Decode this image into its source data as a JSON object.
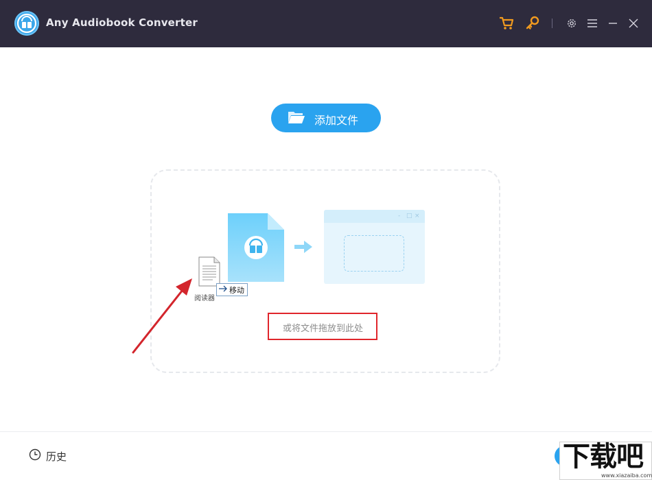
{
  "window": {
    "title": "Any Audiobook Converter",
    "controls": [
      "cart-icon",
      "key-icon",
      "gear-icon",
      "menu-icon",
      "minimize-icon",
      "close-icon"
    ]
  },
  "main": {
    "add_button_label": "添加文件",
    "drop_hint": "或将文件拖放到此处",
    "window_controls": [
      "-",
      "□",
      "×"
    ]
  },
  "drag_overlay": {
    "file_name": "阅读器",
    "tooltip": "移动"
  },
  "footer": {
    "history_label": "历史"
  },
  "watermark": {
    "text": "下载吧",
    "url": "www.xiazaiba.com"
  },
  "colors": {
    "titlebar": "#2e2b3d",
    "accent": "#2aa3ef",
    "orange": "#f29b1f",
    "highlight_red": "#e0252b"
  }
}
